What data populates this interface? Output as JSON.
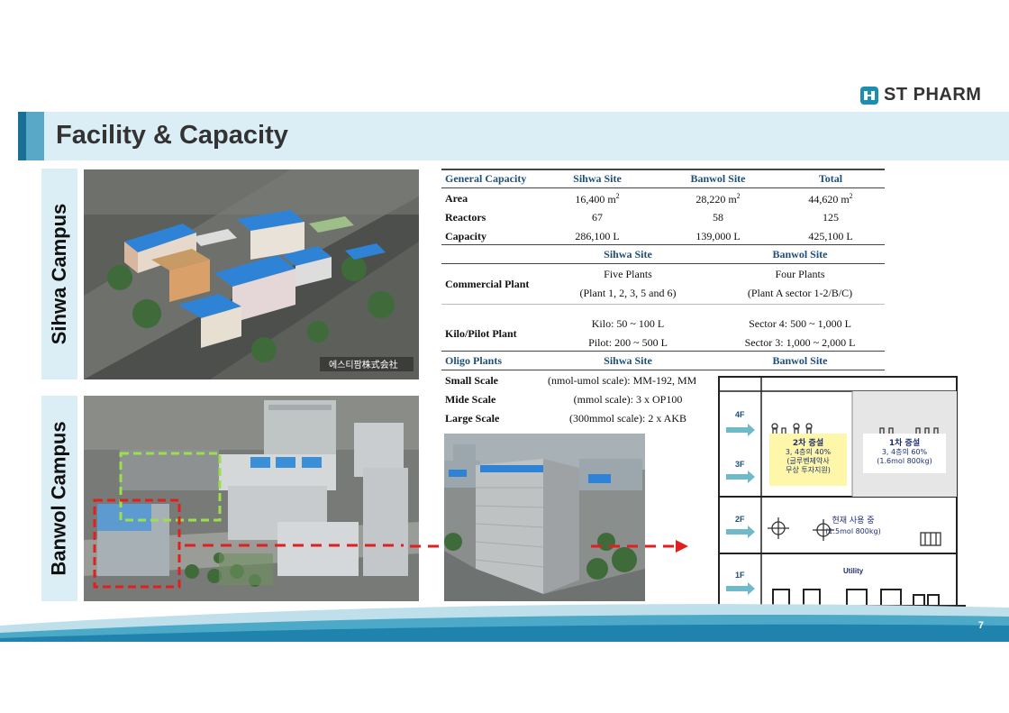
{
  "logo": {
    "text": "ST PHARM"
  },
  "title": "Facility & Capacity",
  "campus": {
    "sihwa": "Sihwa Campus",
    "banwol": "Banwol Campus"
  },
  "photo_watermark": "에스티팜株式会社",
  "table": {
    "general": {
      "headers": [
        "General Capacity",
        "Sihwa Site",
        "Banwol Site",
        "Total"
      ],
      "rows": [
        {
          "label": "Area",
          "sihwa": "16,400 m",
          "banwol": "28,220 m",
          "total": "44,620 m",
          "sup": "2"
        },
        {
          "label": "Reactors",
          "sihwa": "67",
          "banwol": "58",
          "total": "125"
        },
        {
          "label": "Capacity",
          "sihwa": "286,100 L",
          "banwol": "139,000 L",
          "total": "425,100 L"
        }
      ]
    },
    "plants": {
      "headers": [
        "Sihwa Site",
        "Banwol Site"
      ],
      "commercial": {
        "label": "Commercial Plant",
        "sihwa": [
          "Five Plants",
          "(Plant 1, 2, 3, 5 and 6)"
        ],
        "banwol": [
          "Four Plants",
          "(Plant A sector 1-2/B/C)"
        ]
      },
      "kilo": {
        "label": "Kilo/Pilot Plant",
        "sihwa": [
          "Kilo: 50 ~ 100 L",
          "Pilot: 200 ~ 500 L"
        ],
        "banwol": [
          "Sector 4: 500 ~ 1,000 L",
          "Sector 3: 1,000 ~ 2,000 L"
        ]
      }
    },
    "oligo": {
      "headers": [
        "Oligo Plants",
        "Sihwa Site",
        "Banwol Site"
      ],
      "rows": [
        {
          "label": "Small Scale",
          "sihwa": "(nmol-umol scale): MM-192, MM"
        },
        {
          "label": "Mide Scale",
          "sihwa": "(mmol scale): 3 x OP100"
        },
        {
          "label": "Large Scale",
          "sihwa": "(300mmol scale): 2 x AKB"
        }
      ]
    }
  },
  "diagram": {
    "floors": [
      "4F",
      "3F",
      "2F",
      "1F"
    ],
    "box2": [
      "2차 증설",
      "3, 4층의 40%",
      "(글루벤제약사",
      "무상 투자지원)"
    ],
    "box1": [
      "1차 증설",
      "3, 4층의 60%",
      "(1.6mol 800kg)"
    ],
    "current": [
      "현재 사용 중",
      "(1.5mol 800kg)"
    ],
    "utility": "Utility"
  },
  "page_number": "7",
  "colors": {
    "accent": "#1a6f97",
    "band": "#dbeef5",
    "header_text": "#1f4e79",
    "arrow": "#e02020"
  }
}
